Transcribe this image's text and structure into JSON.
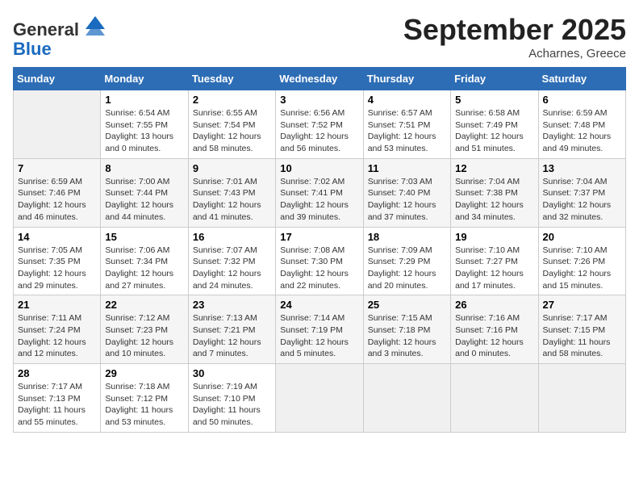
{
  "header": {
    "logo_line1": "General",
    "logo_line2": "Blue",
    "month": "September 2025",
    "location": "Acharnes, Greece"
  },
  "weekdays": [
    "Sunday",
    "Monday",
    "Tuesday",
    "Wednesday",
    "Thursday",
    "Friday",
    "Saturday"
  ],
  "weeks": [
    [
      {
        "day": "",
        "empty": true
      },
      {
        "day": "1",
        "sunrise": "6:54 AM",
        "sunset": "7:55 PM",
        "daylight": "13 hours and 0 minutes."
      },
      {
        "day": "2",
        "sunrise": "6:55 AM",
        "sunset": "7:54 PM",
        "daylight": "12 hours and 58 minutes."
      },
      {
        "day": "3",
        "sunrise": "6:56 AM",
        "sunset": "7:52 PM",
        "daylight": "12 hours and 56 minutes."
      },
      {
        "day": "4",
        "sunrise": "6:57 AM",
        "sunset": "7:51 PM",
        "daylight": "12 hours and 53 minutes."
      },
      {
        "day": "5",
        "sunrise": "6:58 AM",
        "sunset": "7:49 PM",
        "daylight": "12 hours and 51 minutes."
      },
      {
        "day": "6",
        "sunrise": "6:59 AM",
        "sunset": "7:48 PM",
        "daylight": "12 hours and 49 minutes."
      }
    ],
    [
      {
        "day": "7",
        "sunrise": "6:59 AM",
        "sunset": "7:46 PM",
        "daylight": "12 hours and 46 minutes."
      },
      {
        "day": "8",
        "sunrise": "7:00 AM",
        "sunset": "7:44 PM",
        "daylight": "12 hours and 44 minutes."
      },
      {
        "day": "9",
        "sunrise": "7:01 AM",
        "sunset": "7:43 PM",
        "daylight": "12 hours and 41 minutes."
      },
      {
        "day": "10",
        "sunrise": "7:02 AM",
        "sunset": "7:41 PM",
        "daylight": "12 hours and 39 minutes."
      },
      {
        "day": "11",
        "sunrise": "7:03 AM",
        "sunset": "7:40 PM",
        "daylight": "12 hours and 37 minutes."
      },
      {
        "day": "12",
        "sunrise": "7:04 AM",
        "sunset": "7:38 PM",
        "daylight": "12 hours and 34 minutes."
      },
      {
        "day": "13",
        "sunrise": "7:04 AM",
        "sunset": "7:37 PM",
        "daylight": "12 hours and 32 minutes."
      }
    ],
    [
      {
        "day": "14",
        "sunrise": "7:05 AM",
        "sunset": "7:35 PM",
        "daylight": "12 hours and 29 minutes."
      },
      {
        "day": "15",
        "sunrise": "7:06 AM",
        "sunset": "7:34 PM",
        "daylight": "12 hours and 27 minutes."
      },
      {
        "day": "16",
        "sunrise": "7:07 AM",
        "sunset": "7:32 PM",
        "daylight": "12 hours and 24 minutes."
      },
      {
        "day": "17",
        "sunrise": "7:08 AM",
        "sunset": "7:30 PM",
        "daylight": "12 hours and 22 minutes."
      },
      {
        "day": "18",
        "sunrise": "7:09 AM",
        "sunset": "7:29 PM",
        "daylight": "12 hours and 20 minutes."
      },
      {
        "day": "19",
        "sunrise": "7:10 AM",
        "sunset": "7:27 PM",
        "daylight": "12 hours and 17 minutes."
      },
      {
        "day": "20",
        "sunrise": "7:10 AM",
        "sunset": "7:26 PM",
        "daylight": "12 hours and 15 minutes."
      }
    ],
    [
      {
        "day": "21",
        "sunrise": "7:11 AM",
        "sunset": "7:24 PM",
        "daylight": "12 hours and 12 minutes."
      },
      {
        "day": "22",
        "sunrise": "7:12 AM",
        "sunset": "7:23 PM",
        "daylight": "12 hours and 10 minutes."
      },
      {
        "day": "23",
        "sunrise": "7:13 AM",
        "sunset": "7:21 PM",
        "daylight": "12 hours and 7 minutes."
      },
      {
        "day": "24",
        "sunrise": "7:14 AM",
        "sunset": "7:19 PM",
        "daylight": "12 hours and 5 minutes."
      },
      {
        "day": "25",
        "sunrise": "7:15 AM",
        "sunset": "7:18 PM",
        "daylight": "12 hours and 3 minutes."
      },
      {
        "day": "26",
        "sunrise": "7:16 AM",
        "sunset": "7:16 PM",
        "daylight": "12 hours and 0 minutes."
      },
      {
        "day": "27",
        "sunrise": "7:17 AM",
        "sunset": "7:15 PM",
        "daylight": "11 hours and 58 minutes."
      }
    ],
    [
      {
        "day": "28",
        "sunrise": "7:17 AM",
        "sunset": "7:13 PM",
        "daylight": "11 hours and 55 minutes."
      },
      {
        "day": "29",
        "sunrise": "7:18 AM",
        "sunset": "7:12 PM",
        "daylight": "11 hours and 53 minutes."
      },
      {
        "day": "30",
        "sunrise": "7:19 AM",
        "sunset": "7:10 PM",
        "daylight": "11 hours and 50 minutes."
      },
      {
        "day": "",
        "empty": true
      },
      {
        "day": "",
        "empty": true
      },
      {
        "day": "",
        "empty": true
      },
      {
        "day": "",
        "empty": true
      }
    ]
  ]
}
